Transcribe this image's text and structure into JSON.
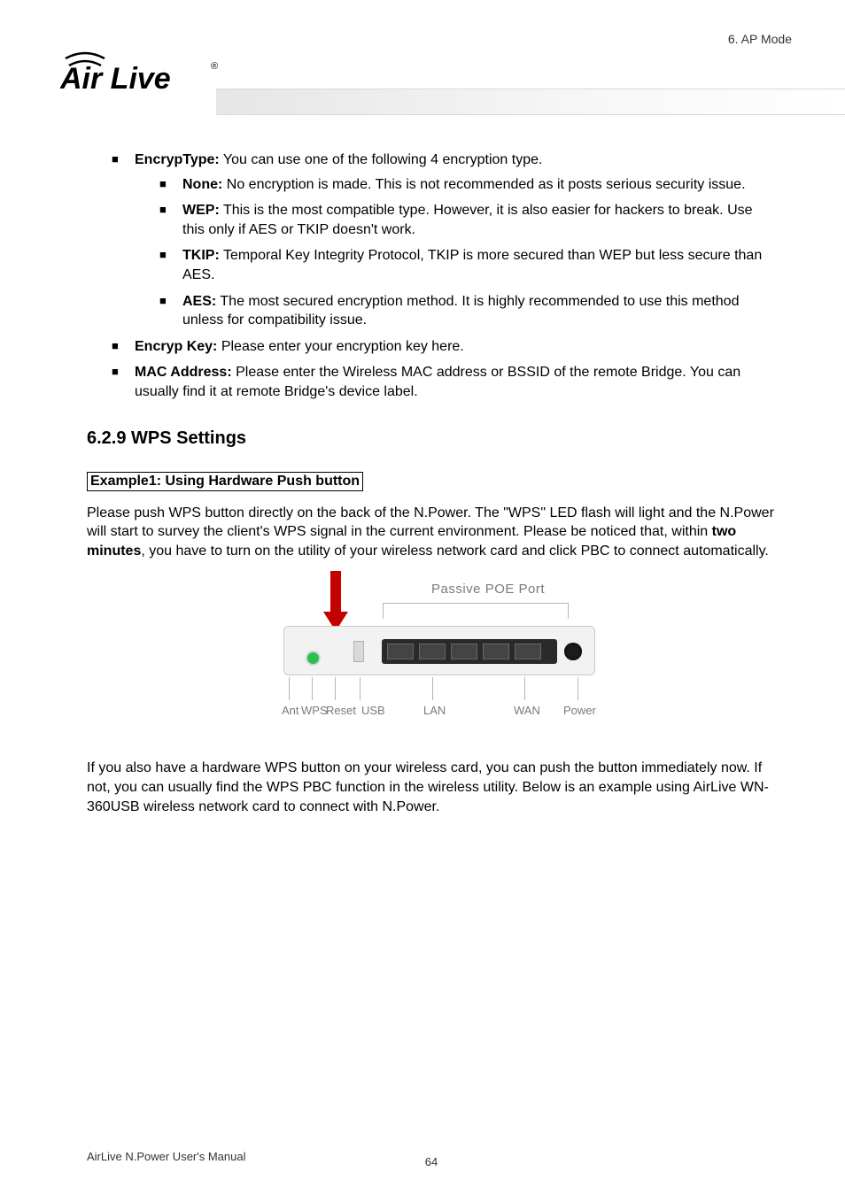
{
  "header": {
    "chapter": "6.  AP  Mode",
    "logo_text": "Air Live",
    "logo_mark": "®"
  },
  "list": {
    "encrypType": {
      "label": "EncrypType:",
      "text": " You can use one of the following 4 encryption type."
    },
    "none": {
      "label": "None:",
      "text": " No encryption is made.    This is not recommended as it posts serious security issue."
    },
    "wep": {
      "label": "WEP:",
      "text": " This is the most compatible type.    However, it is also easier for hackers to break.    Use this only if AES or TKIP doesn't work."
    },
    "tkip": {
      "label": "TKIP:",
      "text": " Temporal Key Integrity Protocol, TKIP is more secured than WEP but less secure than AES."
    },
    "aes": {
      "label": "AES:",
      "text": " The most secured encryption method.    It is highly recommended to use this method unless for compatibility issue."
    },
    "encrypKey": {
      "label": "Encryp Key:",
      "text": " Please enter your encryption key here."
    },
    "mac": {
      "label": "MAC Address:",
      "text": "   Please enter the Wireless MAC address or BSSID of the remote Bridge.    You can usually find it at remote Bridge's device label."
    }
  },
  "section": {
    "title": "6.2.9 WPS Settings",
    "example_title": "Example1: Using Hardware Push button",
    "para1a": "Please push WPS button directly on the back of the N.Power. The \"WPS\" LED flash will light and the N.Power will start to survey the client's WPS signal in the current environment. Please be noticed that, within ",
    "para1_bold": "two minutes",
    "para1b": ", you have to turn on the utility of your wireless network card and click PBC to connect automatically.",
    "para2": "If you also have a hardware WPS button on your wireless card, you can push the button immediately now.    If not, you can usually find the WPS PBC function in the wireless utility.    Below is an example using AirLive WN-360USB wireless network card to connect with N.Power."
  },
  "device": {
    "poe_label": "Passive POE Port",
    "callouts": {
      "ant": "Ant",
      "wps": "WPS",
      "reset": "Reset",
      "usb": "USB",
      "lan": "LAN",
      "wan": "WAN",
      "power": "Power"
    }
  },
  "footer": {
    "manual": "AirLive N.Power User's Manual",
    "page": "64"
  }
}
